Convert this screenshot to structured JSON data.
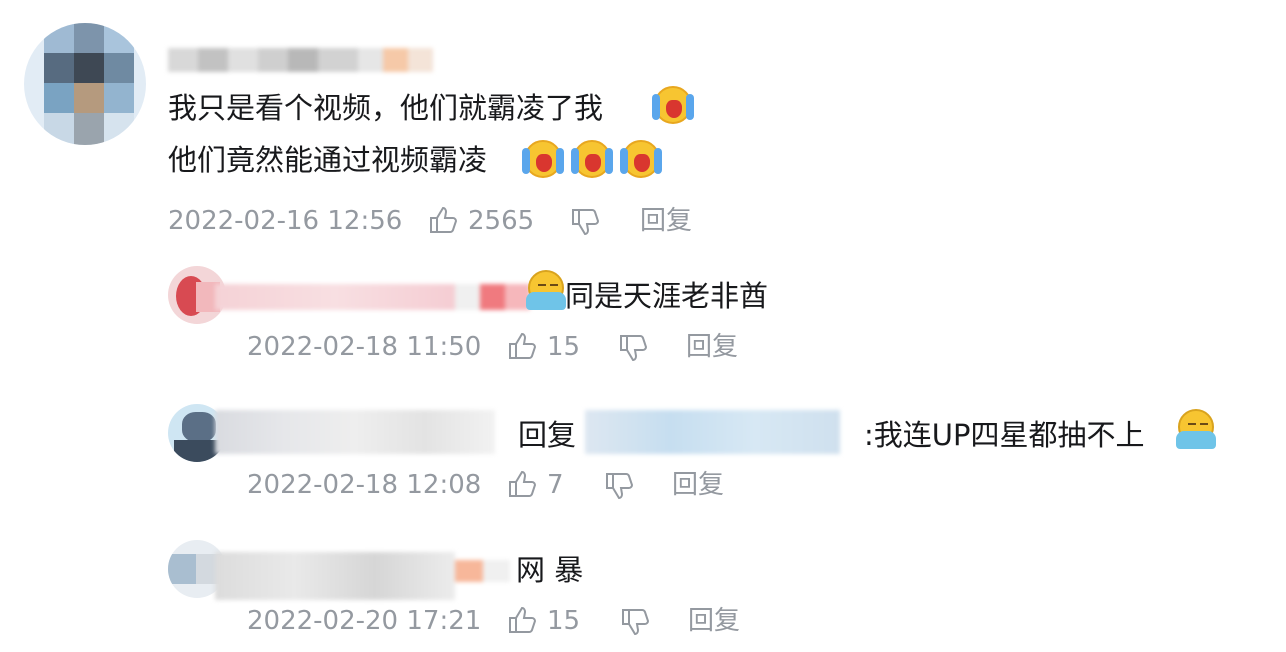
{
  "comments": [
    {
      "lines": [
        "我只是看个视频，他们就霸凌了我",
        "他们竟然能通过视频霸凌"
      ],
      "time": "2022-02-16 12:56",
      "likes": "2565",
      "reply_label": "回复"
    },
    {
      "text": "同是天涯老非酋",
      "time": "2022-02-18 11:50",
      "likes": "15",
      "reply_label": "回复"
    },
    {
      "reply_prefix": "回复",
      "text": ":我连UP四星都抽不上",
      "time": "2022-02-18 12:08",
      "likes": "7",
      "reply_label": "回复"
    },
    {
      "text": "网  暴",
      "time": "2022-02-20 17:21",
      "likes": "15",
      "reply_label": "回复"
    }
  ],
  "icons": {
    "like": "thumbs-up-icon",
    "dislike": "thumbs-down-icon",
    "crying": "loudly-crying-emoji",
    "sweat": "embarrassed-emoji"
  },
  "colors": {
    "meta": "#9499a0",
    "text": "#18191c"
  }
}
